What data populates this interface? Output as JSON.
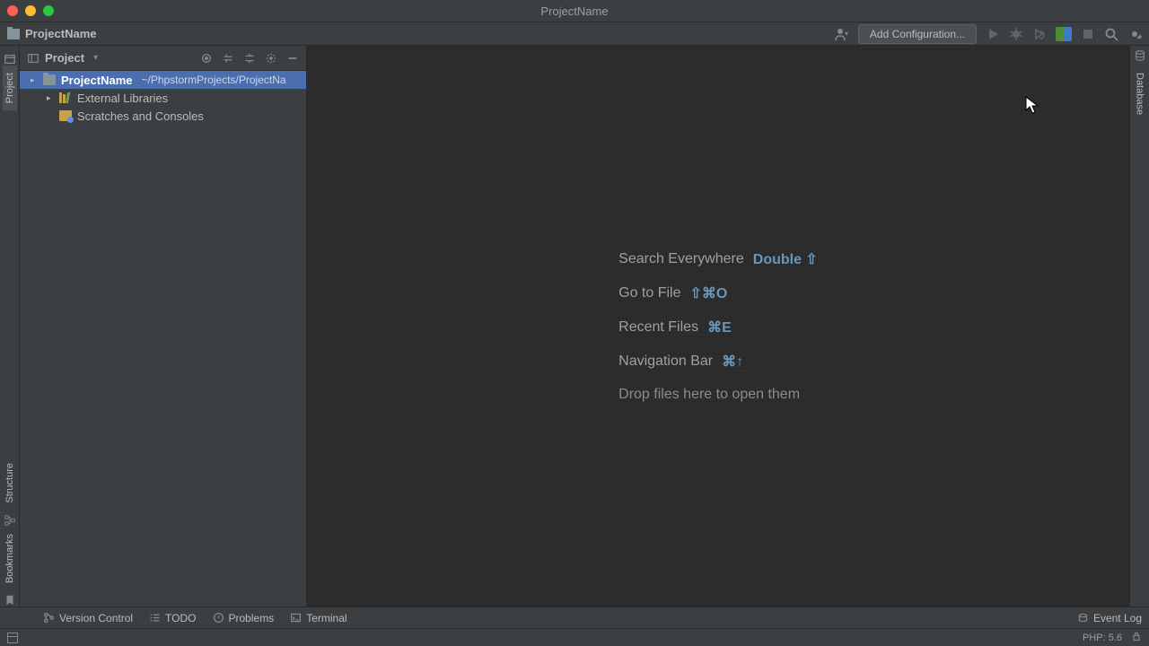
{
  "window": {
    "title": "ProjectName"
  },
  "navbar": {
    "project_name": "ProjectName"
  },
  "toolbar": {
    "add_config": "Add Configuration..."
  },
  "sidebar": {
    "view_label": "Project",
    "root": {
      "name": "ProjectName",
      "path": "~/PhpstormProjects/ProjectNa"
    },
    "ext_libs": "External Libraries",
    "scratches": "Scratches and Consoles"
  },
  "editor_hints": {
    "search_label": "Search Everywhere",
    "search_key": "Double ⇧",
    "gotofile_label": "Go to File",
    "gotofile_key": "⇧⌘O",
    "recent_label": "Recent Files",
    "recent_key": "⌘E",
    "navbar_label": "Navigation Bar",
    "navbar_key": "⌘↑",
    "drop_text": "Drop files here to open them"
  },
  "left_tabs": {
    "project": "Project",
    "bookmarks": "Bookmarks",
    "structure": "Structure"
  },
  "right_tabs": {
    "database": "Database"
  },
  "bottom_tools": {
    "version_control": "Version Control",
    "todo": "TODO",
    "problems": "Problems",
    "terminal": "Terminal",
    "event_log": "Event Log"
  },
  "statusbar": {
    "php": "PHP: 5.6"
  }
}
